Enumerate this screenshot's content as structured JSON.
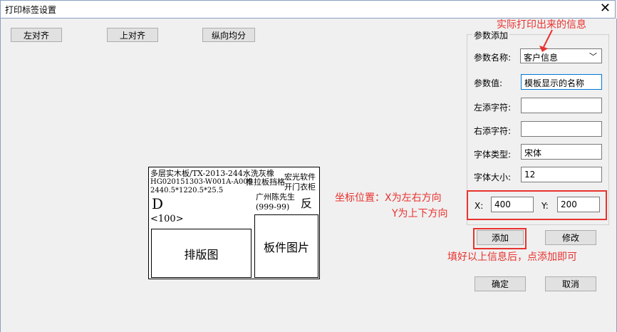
{
  "window": {
    "title": "打印标签设置",
    "close": "✕"
  },
  "toolbar": {
    "align_left": "左对齐",
    "align_top": "上对齐",
    "distribute_vertical": "纵向均分"
  },
  "params": {
    "group_title": "参数添加",
    "name_label": "参数名称:",
    "name_value": "客户信息",
    "value_label": "参数值:",
    "value_value": "模板显示的名称",
    "left_pad_label": "左添字符:",
    "left_pad_value": "",
    "right_pad_label": "右添字符:",
    "right_pad_value": "",
    "font_type_label": "字体类型:",
    "font_type_value": "宋体",
    "font_size_label": "字体大小:",
    "font_size_value": "12",
    "x_label": "X:",
    "x_value": "400",
    "y_label": "Y:",
    "y_value": "200",
    "add_button": "添加",
    "modify_button": "修改"
  },
  "footer": {
    "ok_button": "确定",
    "cancel_button": "取消"
  },
  "preview": {
    "line1": "多层实木板/TX-2013-244水洗灰橡",
    "line2": "HG020151303-W001A-A009",
    "line2b": "推拉板挡格",
    "line3": "2440.5*1220.5*25.5",
    "brand1": "宏光软件",
    "brand2": "开门衣柜",
    "customer": "广州陈先生",
    "phone": "(999-99)",
    "fan": "反",
    "d": "D",
    "count": "<100>",
    "layout_box": "排版图",
    "part_box": "板件图片"
  },
  "annotations": {
    "actual_info": "实际打印出来的信息",
    "coord_line1": "坐标位置：X为左右方向",
    "coord_line2": "Y为上下方向",
    "fill_hint": "填好以上信息后，点添加即可"
  },
  "colors": {
    "annotation": "#e8322e"
  }
}
